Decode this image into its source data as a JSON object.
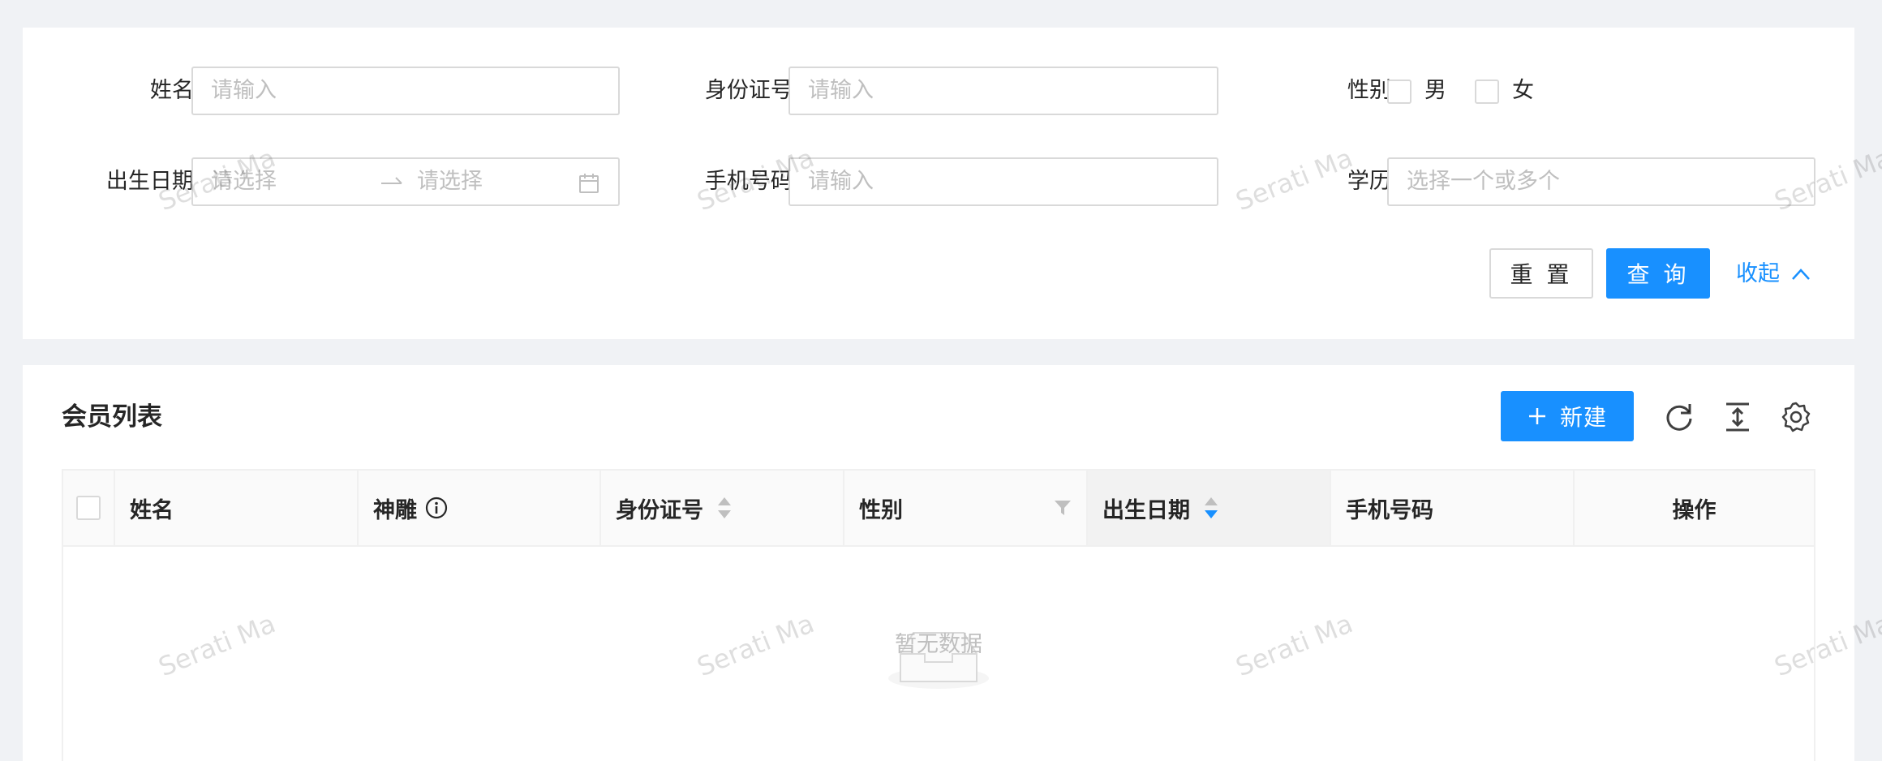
{
  "search": {
    "name_label": "姓名:",
    "name_placeholder": "请输入",
    "id_label": "身份证号:",
    "id_placeholder": "请输入",
    "gender_label": "性别:",
    "gender_options": [
      "男",
      "女"
    ],
    "birth_label": "出生日期:",
    "birth_start_placeholder": "请选择",
    "birth_end_placeholder": "请选择",
    "phone_label": "手机号码:",
    "phone_placeholder": "请输入",
    "edu_label": "学历:",
    "edu_placeholder": "选择一个或多个",
    "reset_label": "重 置",
    "query_label": "查 询",
    "collapse_label": "收起"
  },
  "list": {
    "title": "会员列表",
    "new_button": "新建",
    "columns": [
      "姓名",
      "神雕",
      "身份证号",
      "性别",
      "出生日期",
      "手机号码",
      "操作"
    ],
    "empty_text": "暂无数据"
  },
  "watermark_text": "Serati Ma",
  "colors": {
    "primary": "#1890ff",
    "background": "#f0f2f5",
    "border": "#d9d9d9",
    "placeholder": "#bfbfbf"
  }
}
